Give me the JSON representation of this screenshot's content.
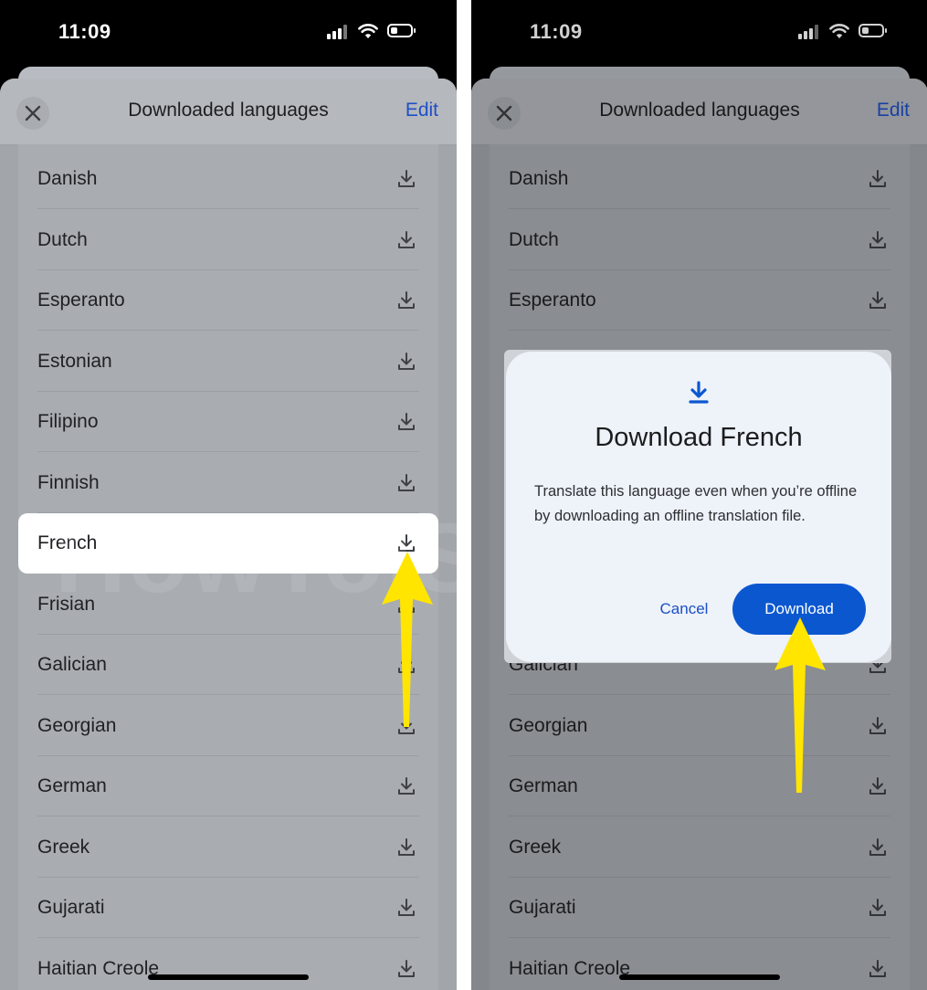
{
  "status": {
    "time": "11:09"
  },
  "sheet": {
    "title": "Downloaded languages",
    "edit_label": "Edit"
  },
  "languages": [
    "Danish",
    "Dutch",
    "Esperanto",
    "Estonian",
    "Filipino",
    "Finnish",
    "French",
    "Frisian",
    "Galician",
    "Georgian",
    "German",
    "Greek",
    "Gujarati",
    "Haitian Creole"
  ],
  "selected_language": "French",
  "dialog": {
    "title": "Download French",
    "body": "Translate this language even when you’re offline by downloading an offline translation file.",
    "cancel_label": "Cancel",
    "download_label": "Download"
  },
  "watermark": "HowToiSolve.com",
  "colors": {
    "accent": "#0b57d0",
    "link": "#1f4fc7",
    "arrow": "#ffe500"
  },
  "icons": [
    "close-icon",
    "download-icon",
    "cellular-signal-icon",
    "wifi-icon",
    "battery-icon"
  ]
}
